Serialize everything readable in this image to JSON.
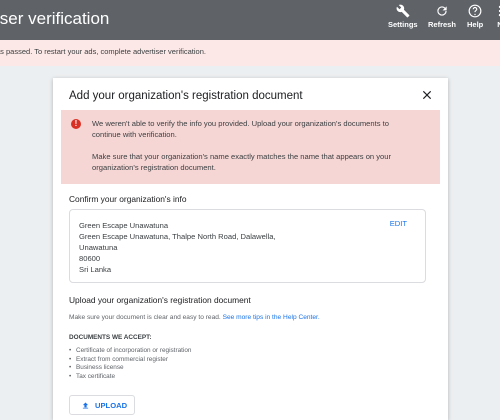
{
  "appbar": {
    "title": "iser verification",
    "actions": [
      {
        "label": "Settings",
        "icon": "wrench-icon"
      },
      {
        "label": "Refresh",
        "icon": "refresh-icon"
      },
      {
        "label": "Help",
        "icon": "help-icon"
      },
      {
        "label": "N",
        "icon": "more-icon"
      }
    ],
    "bg_color": "#5f6368"
  },
  "banner": {
    "text": "as passed. To restart your ads, complete advertiser verification.",
    "bg_color": "#fce8e6"
  },
  "dialog": {
    "title": "Add your organization's registration document",
    "close_icon": "close-icon",
    "error": {
      "icon": "error-icon",
      "icon_glyph": "!",
      "line1": "We weren't able to verify the info you provided. Upload your organization's documents to",
      "line2": "continue with verification.",
      "line3": "Make sure that your organization's name exactly matches the name that appears on your",
      "line4": "organization's registration document.",
      "bg_color": "#f6d6d4"
    },
    "confirm": {
      "title": "Confirm your organization's info",
      "edit_label": "EDIT",
      "lines": [
        "Green Escape Unawatuna",
        "Green Escape Unawatuna, Thalpe North Road, Dalawella,",
        "Unawatuna",
        "80600",
        "Sri Lanka"
      ]
    },
    "upload_section": {
      "title": "Upload your organization's registration document",
      "hint": "Make sure your document is clear and easy to read. ",
      "hint_link": "See more tips in the Help Center.",
      "docs_heading": "DOCUMENTS WE ACCEPT:",
      "docs": [
        "Certificate of incorporation or registration",
        "Extract from commercial register",
        "Business license",
        "Tax certificate"
      ],
      "upload_label": "UPLOAD",
      "upload_icon": "upload-icon",
      "accent_color": "#1a73e8"
    }
  }
}
